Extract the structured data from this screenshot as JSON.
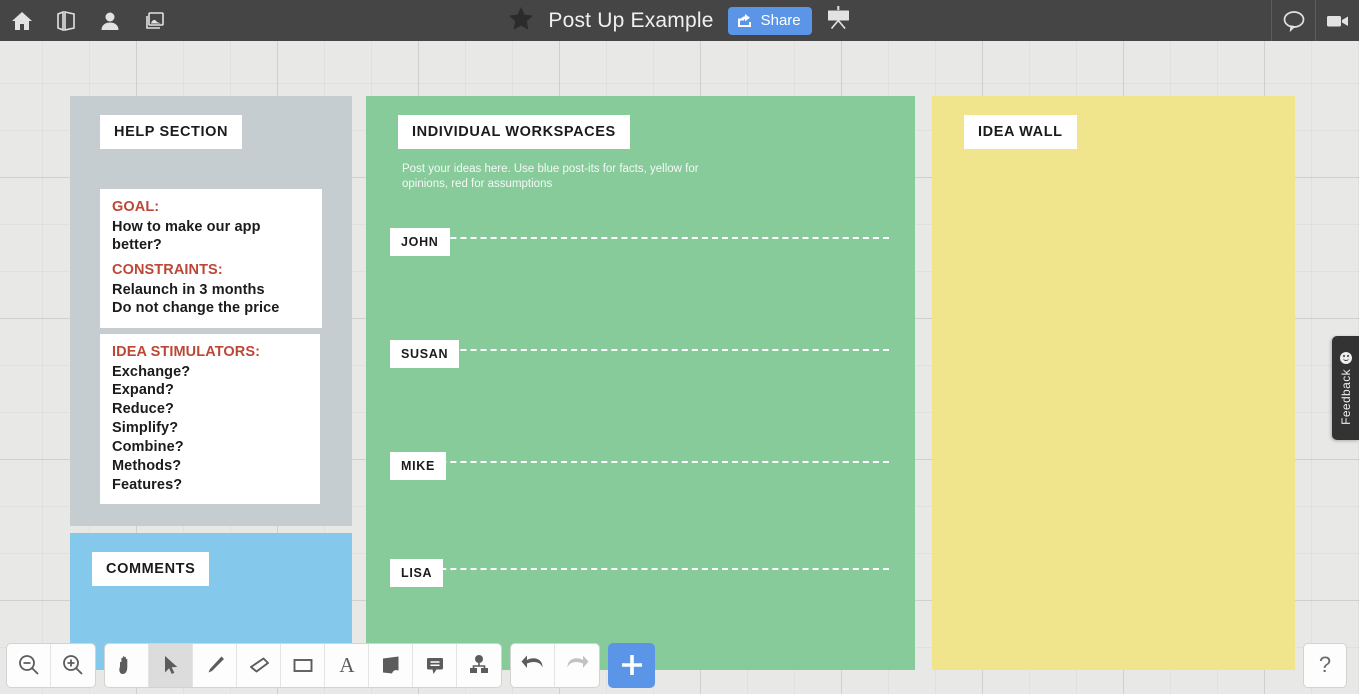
{
  "topbar": {
    "left_icons": [
      {
        "name": "home-icon",
        "label": "Home"
      },
      {
        "name": "panels-icon",
        "label": "Panels"
      },
      {
        "name": "people-icon",
        "label": "People"
      },
      {
        "name": "images-icon",
        "label": "Images"
      }
    ],
    "star_icon": "star-icon",
    "title": "Post Up Example",
    "share_label": "Share",
    "share_icon": "share-icon",
    "present_icon": "presentation-icon",
    "right_icons": [
      {
        "name": "chat-icon",
        "label": "Chat"
      },
      {
        "name": "video-icon",
        "label": "Video"
      }
    ]
  },
  "colors": {
    "topbar_bg": "#454545",
    "canvas_bg": "#e8e8e6",
    "accent_blue": "#5b95e8",
    "help_panel": "#c5cdd1",
    "comments_panel": "#84c8ec",
    "workspace_panel": "#87cb9b",
    "ideawall_panel": "#f0e58c",
    "note_heading": "#bd4737",
    "note_bg": "#ffffff"
  },
  "help_panel": {
    "label": "HELP SECTION",
    "cards": [
      {
        "name": "goal-card",
        "heading": "GOAL:",
        "lines": [
          "How to make our app better?"
        ]
      },
      {
        "name": "constraints-card",
        "heading": "CONSTRAINTS:",
        "lines": [
          "Relaunch in 3 months",
          "Do not change the price"
        ]
      },
      {
        "name": "idea-stimulators-card",
        "heading": "IDEA STIMULATORS:",
        "lines": [
          "Exchange?",
          "Expand?",
          "Reduce?",
          "Simplify?",
          "Combine?",
          "Methods?",
          "Features?"
        ]
      }
    ]
  },
  "comments_panel": {
    "label": "COMMENTS"
  },
  "workspace_panel": {
    "label": "INDIVIDUAL WORKSPACES",
    "instructions": "Post your ideas here. Use blue post-its for facts, yellow for opinions, red for assumptions",
    "rows": [
      {
        "name": "JOHN"
      },
      {
        "name": "SUSAN"
      },
      {
        "name": "MIKE"
      },
      {
        "name": "LISA"
      }
    ]
  },
  "ideawall_panel": {
    "label": "IDEA WALL"
  },
  "bottombar": {
    "groups": [
      {
        "name": "zoom-group",
        "tools": [
          {
            "name": "zoom-out-tool",
            "label": "Zoom Out",
            "active": false,
            "disabled": false
          },
          {
            "name": "zoom-in-tool",
            "label": "Zoom In",
            "active": false,
            "disabled": false
          }
        ]
      },
      {
        "name": "draw-group",
        "tools": [
          {
            "name": "hand-tool",
            "label": "Pan",
            "active": false,
            "disabled": false
          },
          {
            "name": "select-tool",
            "label": "Select",
            "active": true,
            "disabled": false
          },
          {
            "name": "pen-tool",
            "label": "Pen",
            "active": false,
            "disabled": false
          },
          {
            "name": "eraser-tool",
            "label": "Eraser",
            "active": false,
            "disabled": false
          },
          {
            "name": "rectangle-tool",
            "label": "Rectangle",
            "active": false,
            "disabled": false
          },
          {
            "name": "text-tool",
            "label": "Text",
            "active": false,
            "disabled": false
          },
          {
            "name": "sticky-note-tool",
            "label": "Sticky Note",
            "active": false,
            "disabled": false
          },
          {
            "name": "comment-tool",
            "label": "Comment",
            "active": false,
            "disabled": false
          },
          {
            "name": "connector-tool",
            "label": "Connector",
            "active": false,
            "disabled": false
          }
        ]
      },
      {
        "name": "history-group",
        "tools": [
          {
            "name": "undo-tool",
            "label": "Undo",
            "active": false,
            "disabled": false
          },
          {
            "name": "redo-tool",
            "label": "Redo",
            "active": false,
            "disabled": true
          }
        ]
      }
    ],
    "add_label": "+",
    "help_label": "?"
  },
  "feedback": {
    "label": "Feedback",
    "icon": "smiley-face-icon"
  }
}
